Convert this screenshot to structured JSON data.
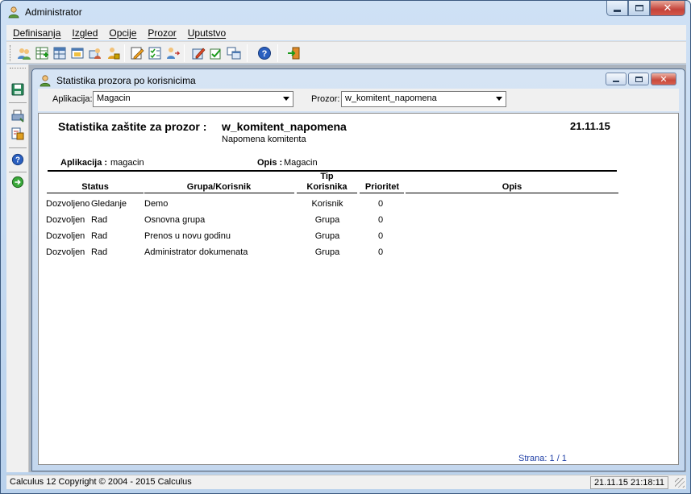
{
  "window": {
    "title": "Administrator",
    "icon": "user-icon"
  },
  "menu": [
    "Definisanja",
    "Izgled",
    "Opcije",
    "Prozor",
    "Uputstvo"
  ],
  "toolbar": {
    "icons": [
      "users-icon",
      "add-table-icon",
      "table-icon",
      "window-icon",
      "group-icon",
      "user-lock-icon",
      "edit-icon",
      "checklist-icon",
      "user-transfer-icon",
      "pencil-icon",
      "check-edit-icon",
      "copy-window-icon",
      "help-icon",
      "exit-icon"
    ]
  },
  "lefttoolbar": {
    "icons": [
      "save-icon",
      "print-icon",
      "print-preview-icon",
      "help-icon",
      "exit-icon"
    ]
  },
  "child": {
    "title": "Statistika prozora po korisnicima",
    "filters": {
      "aplikacija_label": "Aplikacija:",
      "aplikacija_value": "Magacin",
      "prozor_label": "Prozor:",
      "prozor_value": "w_komitent_napomena"
    },
    "report": {
      "title_label": "Statistika zaštite za prozor :",
      "title_value": "w_komitent_napomena",
      "subtitle": "Napomena komitenta",
      "date": "21.11.15",
      "aplikacija_label": "Aplikacija :",
      "aplikacija_value": "magacin",
      "opis_label": "Opis :",
      "opis_value": "Magacin",
      "columns": {
        "status": "Status",
        "grupa": "Grupa/Korisnik",
        "tip_line1": "Tip",
        "tip_line2": "Korisnika",
        "prioritet": "Prioritet",
        "opis": "Opis"
      },
      "rows": [
        {
          "status": "Dozvoljeno",
          "pravo": "Gledanje",
          "grupa": "Demo",
          "tip": "Korisnik",
          "prioritet": "0",
          "opis": ""
        },
        {
          "status": "Dozvoljen",
          "pravo": "Rad",
          "grupa": "Osnovna grupa",
          "tip": "Grupa",
          "prioritet": "0",
          "opis": ""
        },
        {
          "status": "Dozvoljen",
          "pravo": "Rad",
          "grupa": "Prenos u novu godinu",
          "tip": "Grupa",
          "prioritet": "0",
          "opis": ""
        },
        {
          "status": "Dozvoljen",
          "pravo": "Rad",
          "grupa": "Administrator dokumenata",
          "tip": "Grupa",
          "prioritet": "0",
          "opis": ""
        }
      ],
      "pager": "Strana:  1 / 1"
    }
  },
  "status": {
    "left": "Calculus 12  Copyright © 2004 - 2015  Calculus",
    "right": "21.11.15 21:18:11"
  }
}
